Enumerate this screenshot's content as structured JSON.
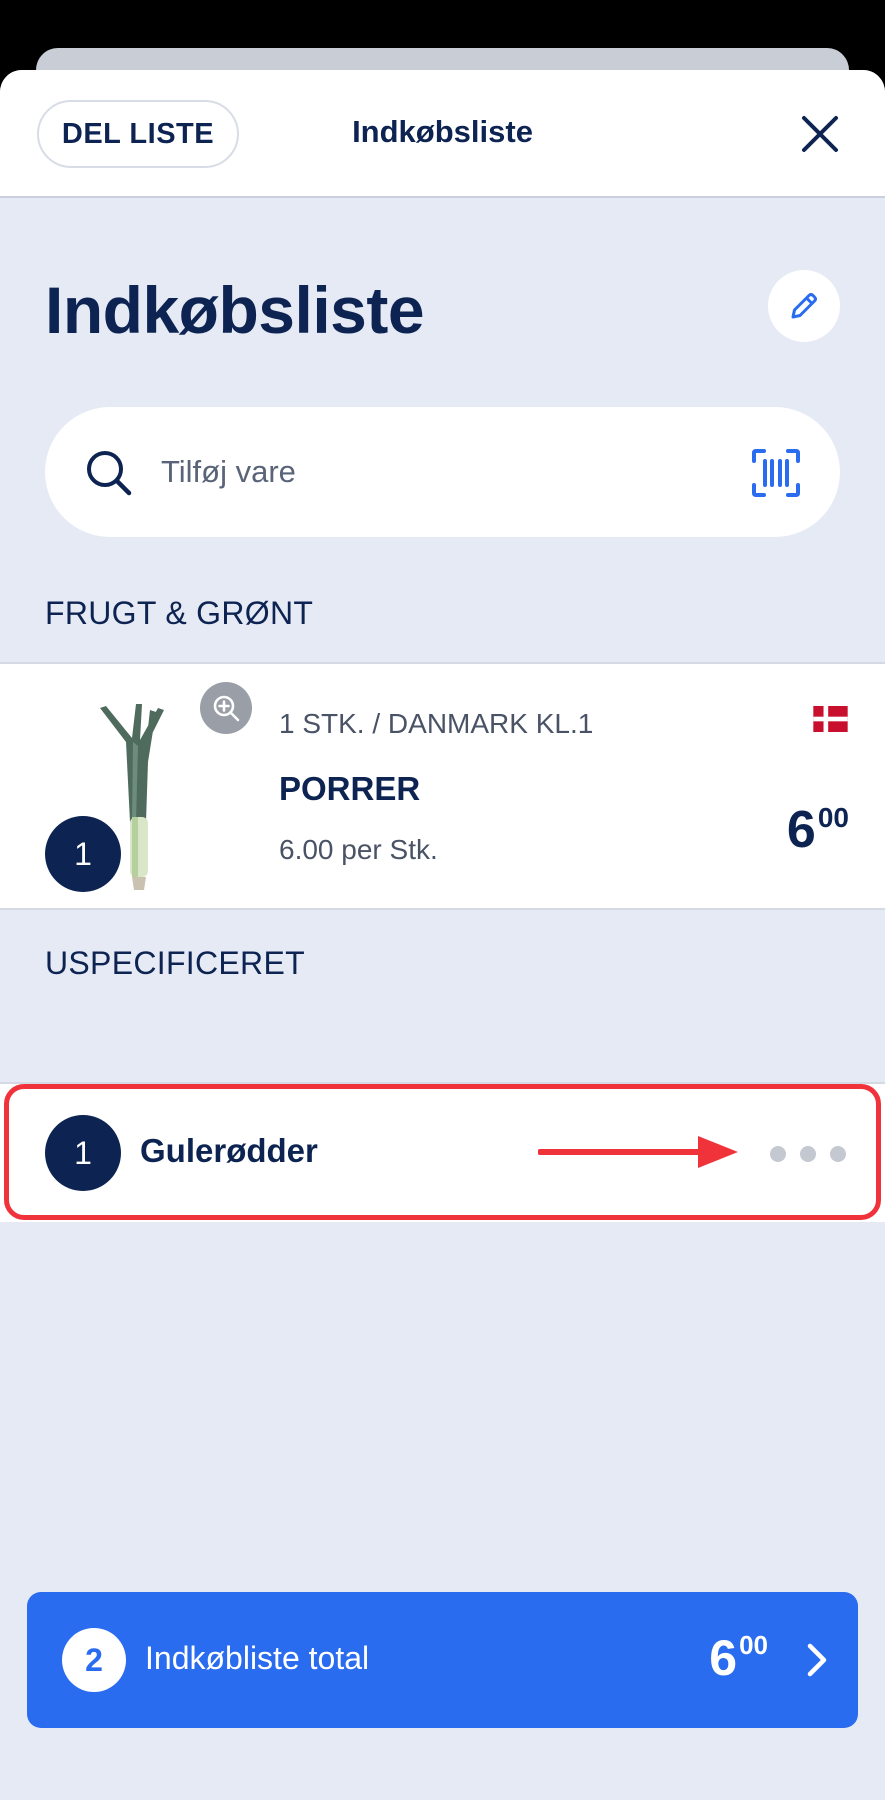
{
  "header": {
    "share_label": "DEL LISTE",
    "title": "Indkøbsliste"
  },
  "page": {
    "title": "Indkøbsliste"
  },
  "search": {
    "placeholder": "Tilføj vare"
  },
  "sections": [
    {
      "title": "FRUGT & GRØNT",
      "items": [
        {
          "quantity": "1",
          "subtitle": "1 STK. / DANMARK KL.1",
          "name": "PORRER",
          "unit_price": "6.00 per Stk.",
          "price_int": "6",
          "price_dec": "00",
          "origin_flag": "denmark-flag"
        }
      ]
    },
    {
      "title": "USPECIFICERET",
      "items": [
        {
          "quantity": "1",
          "name": "Gulerødder"
        }
      ]
    }
  ],
  "total": {
    "count": "2",
    "label": "Indkøbliste total",
    "price_int": "6",
    "price_dec": "00"
  },
  "colors": {
    "navy": "#0d2452",
    "accent_blue": "#2a6cf0",
    "background": "#e6eaf5",
    "highlight_red": "#f0333b"
  },
  "icons": [
    "close-icon",
    "pencil-icon",
    "search-icon",
    "barcode-scan-icon",
    "zoom-in-icon",
    "chevron-right-icon",
    "more-dots-icon"
  ]
}
